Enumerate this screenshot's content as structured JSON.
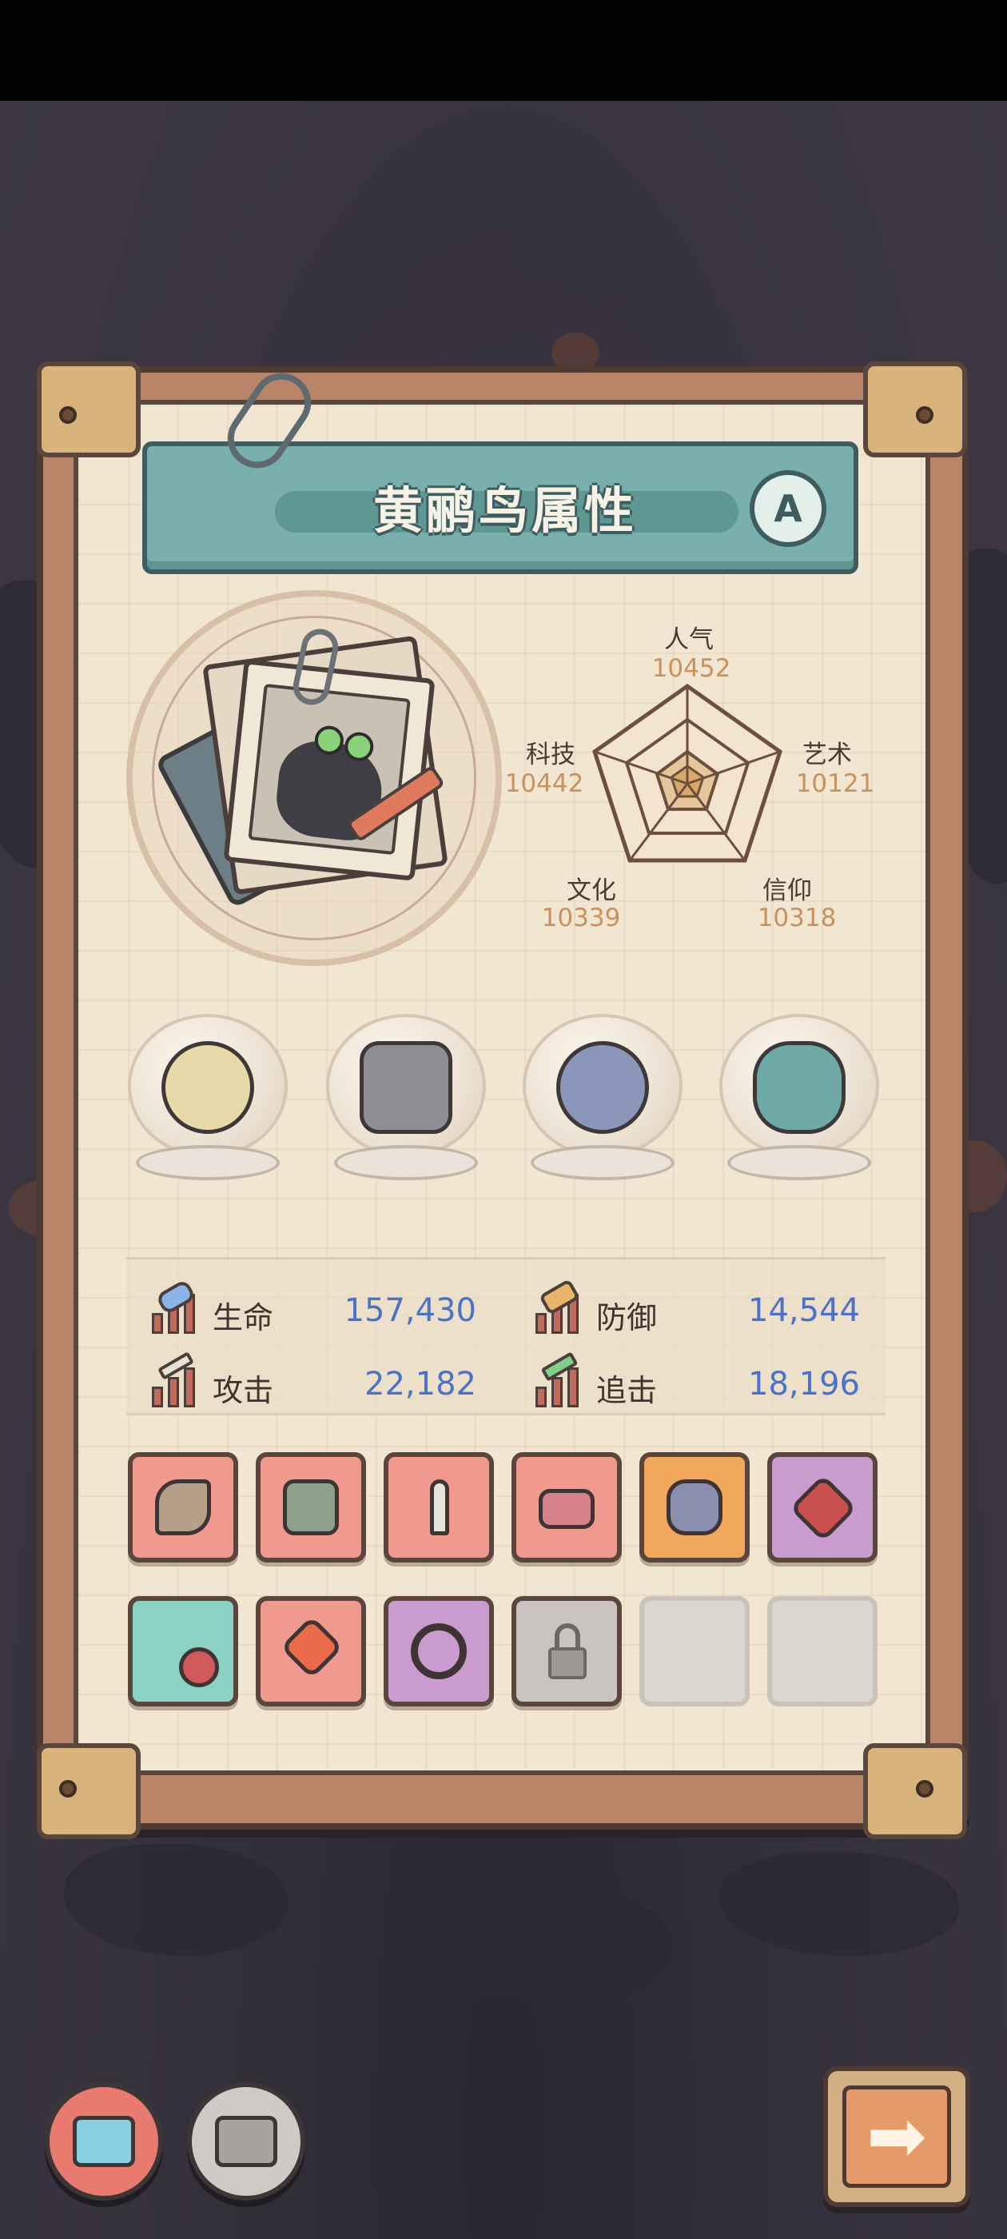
{
  "title": "黄鹂鸟属性",
  "grade": "A",
  "attributes": [
    {
      "key": "popularity",
      "label": "人气",
      "value": "10452"
    },
    {
      "key": "art",
      "label": "艺术",
      "value": "10121"
    },
    {
      "key": "faith",
      "label": "信仰",
      "value": "10318"
    },
    {
      "key": "culture",
      "label": "文化",
      "value": "10339"
    },
    {
      "key": "technology",
      "label": "科技",
      "value": "10442"
    }
  ],
  "combat_stats": [
    {
      "key": "hp",
      "label": "生命",
      "value": "157,430",
      "icon": "health-bar-icon"
    },
    {
      "key": "defense",
      "label": "防御",
      "value": "14,544",
      "icon": "shield-icon"
    },
    {
      "key": "attack",
      "label": "攻击",
      "value": "22,182",
      "icon": "sword-icon"
    },
    {
      "key": "pursuit",
      "label": "追击",
      "value": "18,196",
      "icon": "arrow-icon"
    }
  ],
  "relics": [
    "dna-helix-relic-icon",
    "robot-fist-relic-icon",
    "compass-relic-icon",
    "dragon-mask-relic-icon"
  ],
  "equipment": [
    {
      "icon": "blaster-gun-icon",
      "rarity": "red"
    },
    {
      "icon": "war-hammer-icon",
      "rarity": "red"
    },
    {
      "icon": "dagger-icon",
      "rarity": "red"
    },
    {
      "icon": "bracer-icon",
      "rarity": "red"
    },
    {
      "icon": "chest-armor-icon",
      "rarity": "orange"
    },
    {
      "icon": "amulet-icon",
      "rarity": "purple"
    },
    {
      "icon": "chain-flail-icon",
      "rarity": "teal"
    },
    {
      "icon": "spiked-mace-icon",
      "rarity": "red"
    },
    {
      "icon": "gem-ring-icon",
      "rarity": "purple"
    },
    {
      "icon": "lock-icon",
      "rarity": "locked"
    },
    {
      "icon": "",
      "rarity": "empty"
    },
    {
      "icon": "",
      "rarity": "empty"
    }
  ],
  "bottom_buttons": [
    "character-icon",
    "robot-icon",
    "next-arrow-icon"
  ],
  "colors": {
    "banner": "#79b0ac",
    "stat_value": "#4a73c7",
    "attribute_value": "#c9915e",
    "slot_red": "#f0998e",
    "slot_orange": "#f2a85a",
    "slot_purple": "#c99bcf",
    "slot_teal": "#8bd1c4"
  }
}
